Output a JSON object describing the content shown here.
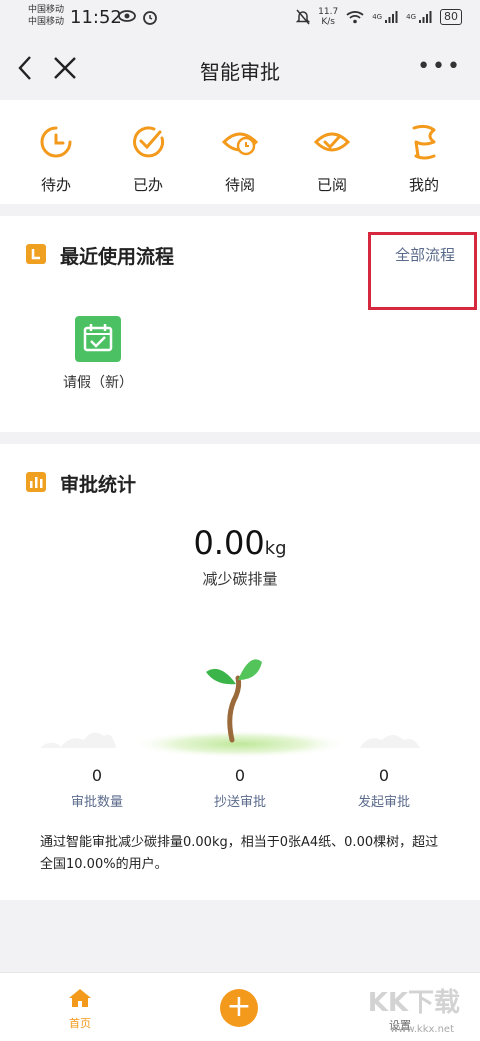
{
  "status_bar": {
    "carrier_1": "中国移动",
    "carrier_2": "中国移动",
    "time": "11:52",
    "net_speed_value": "11.7",
    "net_speed_unit": "K/s",
    "signal_1": "4G",
    "signal_2": "4G",
    "battery": "80"
  },
  "nav": {
    "title": "智能审批"
  },
  "quick_actions": [
    {
      "label": "待办",
      "icon": "clock-icon"
    },
    {
      "label": "已办",
      "icon": "check-circle-icon"
    },
    {
      "label": "待阅",
      "icon": "eye-clock-icon"
    },
    {
      "label": "已阅",
      "icon": "eye-check-icon"
    },
    {
      "label": "我的",
      "icon": "flag-icon"
    }
  ],
  "recent": {
    "title": "最近使用流程",
    "all_link": "全部流程",
    "process": {
      "label": "请假（新）",
      "icon": "calendar-check-icon"
    }
  },
  "stats": {
    "title": "审批统计",
    "carbon_value": "0.00",
    "carbon_unit": "kg",
    "carbon_label": "减少碳排量",
    "columns": [
      {
        "value": "0",
        "label": "审批数量"
      },
      {
        "value": "0",
        "label": "抄送审批"
      },
      {
        "value": "0",
        "label": "发起审批"
      }
    ],
    "summary": "通过智能审批减少碳排量0.00kg，相当于0张A4纸、0.00棵树，超过全国10.00%的用户。"
  },
  "tabbar": {
    "home": "首页",
    "settings": "设置"
  },
  "watermark": {
    "text": "KK下载",
    "url": "www.kkx.net"
  },
  "colors": {
    "accent": "#f39a1c",
    "link": "#5b6b8c",
    "highlight": "#d6283e",
    "process_icon": "#4cc163"
  }
}
